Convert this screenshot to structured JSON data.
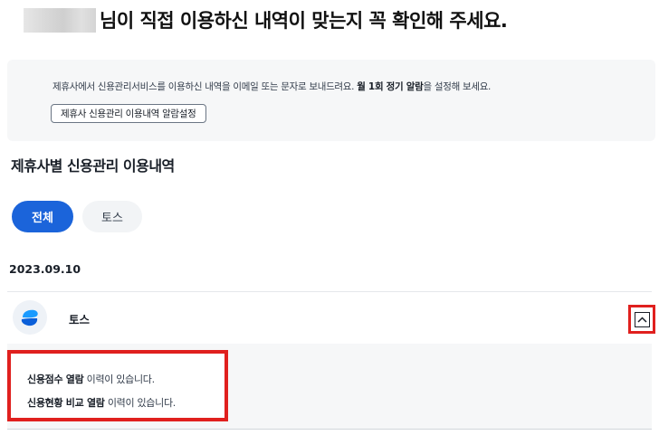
{
  "header": {
    "title": "님이 직접 이용하신 내역이 맞는지 꼭 확인해 주세요."
  },
  "notice": {
    "text_prefix": "제휴사에서 신용관리서비스를 이용하신 내역을 이메일 또는 문자로 보내드려요. ",
    "text_bold": "월 1회 정기 알람",
    "text_suffix": "을 설정해 보세요.",
    "button_label": "제휴사 신용관리 이용내역 알람설정"
  },
  "section": {
    "title": "제휴사별 신용관리 이용내역"
  },
  "tabs": [
    {
      "label": "전체",
      "active": true
    },
    {
      "label": "토스",
      "active": false
    }
  ],
  "history": {
    "date": "2023.09.10",
    "company": {
      "name": "토스",
      "logo_icon": "toss-logo-icon",
      "expanded": true
    },
    "details": [
      {
        "bold": "신용점수 열람",
        "rest": " 이력이 있습니다."
      },
      {
        "bold": "신용현황 비교 열람",
        "rest": " 이력이 있습니다."
      }
    ]
  },
  "colors": {
    "accent": "#1b64da",
    "highlight": "#e0201e",
    "panel_bg": "#f6f7f8",
    "tab_inactive_bg": "#f2f4f6",
    "logo_blue": "#1a9bff"
  }
}
